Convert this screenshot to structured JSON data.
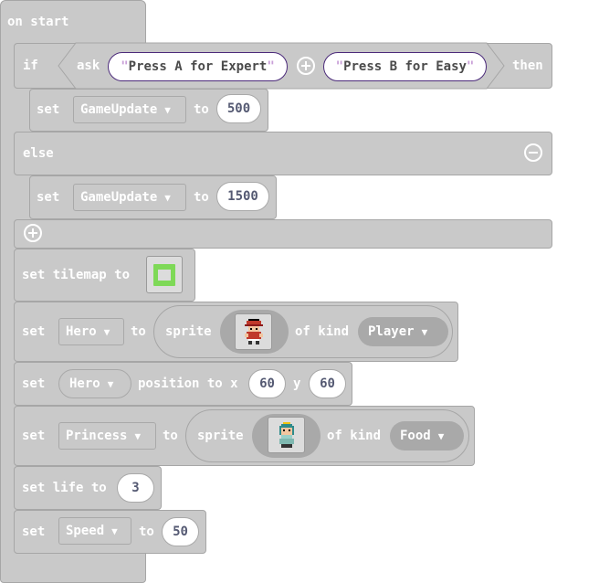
{
  "on_start": {
    "label": "on start"
  },
  "if_block": {
    "if_label": "if",
    "ask_label": "ask",
    "str1": "Press A for Expert",
    "str2": "Press B for Easy",
    "then_label": "then",
    "else_label": "else"
  },
  "set1": {
    "set": "set",
    "var": "GameUpdate",
    "to": "to",
    "value": "500"
  },
  "set2": {
    "set": "set",
    "var": "GameUpdate",
    "to": "to",
    "value": "1500"
  },
  "tilemap": {
    "label": "set tilemap to"
  },
  "hero_sprite": {
    "set": "set",
    "var": "Hero",
    "to": "to",
    "sprite": "sprite",
    "of_kind": "of kind",
    "kind": "Player"
  },
  "hero_pos": {
    "set": "set",
    "var": "Hero",
    "position_to_x": "position to x",
    "x": "60",
    "y_label": "y",
    "y": "60"
  },
  "princess_sprite": {
    "set": "set",
    "var": "Princess",
    "to": "to",
    "sprite": "sprite",
    "of_kind": "of kind",
    "kind": "Food"
  },
  "life": {
    "label": "set life to",
    "value": "3"
  },
  "speed": {
    "set": "set",
    "var": "Speed",
    "to": "to",
    "value": "50"
  },
  "icons": {
    "add_else": "plus-circle-icon",
    "remove_else": "minus-circle-icon",
    "add_elseif": "plus-circle-icon",
    "dropdown": "caret-down-icon"
  },
  "colors": {
    "block": "#c9c9c9",
    "block_border": "#a6a6a6",
    "string_border": "#4b2a7a"
  }
}
